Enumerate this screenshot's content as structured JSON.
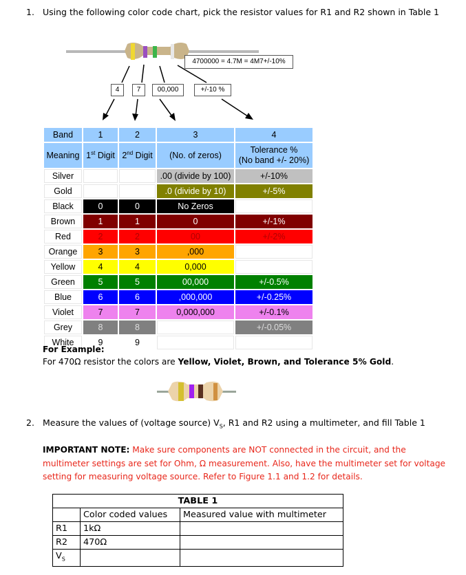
{
  "question1": {
    "number": "1.",
    "text": "Using the following color code chart, pick the resistor values for R1 and R2 shown in Table 1"
  },
  "diagram": {
    "equation": "4700000 = 4.7M = 4M7+/-10%",
    "callouts": [
      "4",
      "7",
      "00,000",
      "+/-10 %"
    ],
    "bands": [
      "#f0d830",
      "#9a4fc0",
      "#3cb54a",
      "#e8e8e8"
    ],
    "body_color": "#c9b48a"
  },
  "color_code_table": {
    "header_band": [
      "Band",
      "1",
      "2",
      "3",
      "4"
    ],
    "header_meaning": {
      "label": "Meaning",
      "digit1": "1",
      "digit1_sup": "st",
      "digit1_suffix": " Digit",
      "digit2": "2",
      "digit2_sup": "nd",
      "digit2_suffix": " Digit",
      "zeros": "(No. of zeros)",
      "tolerance_line1": "Tolerance %",
      "tolerance_line2": "(No band +/- 20%)"
    },
    "rows": [
      {
        "name": "Silver",
        "d1": "",
        "d2": "",
        "zeros": ".00 (divide by 100)",
        "tol": "+/-10%",
        "bg": "#c0c0c0",
        "fg": "#000000",
        "digit_bg": "",
        "zeros_bg": "#c0c0c0",
        "tol_bg": "#c0c0c0"
      },
      {
        "name": "Gold",
        "d1": "",
        "d2": "",
        "zeros": ".0 (divide by 10)",
        "tol": "+/-5%",
        "bg": "#808000",
        "fg": "#ffffff",
        "digit_bg": "",
        "zeros_bg": "#808000",
        "tol_bg": "#808000"
      },
      {
        "name": "Black",
        "d1": "0",
        "d2": "0",
        "zeros": "No Zeros",
        "tol": "",
        "bg": "#000000",
        "fg": "#ffffff",
        "digit_bg": "#000000",
        "zeros_bg": "#000000",
        "tol_bg": ""
      },
      {
        "name": "Brown",
        "d1": "1",
        "d2": "1",
        "zeros": "0",
        "tol": "+/-1%",
        "bg": "#800000",
        "fg": "#ffffff",
        "digit_bg": "#800000",
        "zeros_bg": "#800000",
        "tol_bg": "#800000"
      },
      {
        "name": "Red",
        "d1": "2",
        "d2": "2",
        "zeros": "00",
        "tol": "+/-2%",
        "bg": "#ff0000",
        "fg": "#b00000",
        "digit_bg": "#ff0000",
        "zeros_bg": "#ff0000",
        "tol_bg": "#ff0000"
      },
      {
        "name": "Orange",
        "d1": "3",
        "d2": "3",
        "zeros": ",000",
        "tol": "",
        "bg": "#ffa500",
        "fg": "#000000",
        "digit_bg": "#ffa500",
        "zeros_bg": "#ffa500",
        "tol_bg": ""
      },
      {
        "name": "Yellow",
        "d1": "4",
        "d2": "4",
        "zeros": "0,000",
        "tol": "",
        "bg": "#ffff00",
        "fg": "#000000",
        "digit_bg": "#ffff00",
        "zeros_bg": "#ffff00",
        "tol_bg": ""
      },
      {
        "name": "Green",
        "d1": "5",
        "d2": "5",
        "zeros": "00,000",
        "tol": "+/-0.5%",
        "bg": "#008000",
        "fg": "#ffffff",
        "digit_bg": "#008000",
        "zeros_bg": "#008000",
        "tol_bg": "#008000"
      },
      {
        "name": "Blue",
        "d1": "6",
        "d2": "6",
        "zeros": ",000,000",
        "tol": "+/-0.25%",
        "bg": "#0000ff",
        "fg": "#ffffff",
        "digit_bg": "#0000ff",
        "zeros_bg": "#0000ff",
        "tol_bg": "#0000ff"
      },
      {
        "name": "Violet",
        "d1": "7",
        "d2": "7",
        "zeros": "0,000,000",
        "tol": "+/-0.1%",
        "bg": "#ee82ee",
        "fg": "#000000",
        "digit_bg": "#ee82ee",
        "zeros_bg": "#ee82ee",
        "tol_bg": "#ee82ee"
      },
      {
        "name": "Grey",
        "d1": "8",
        "d2": "8",
        "zeros": "",
        "tol": "+/-0.05%",
        "bg": "#808080",
        "fg": "#dddddd",
        "digit_bg": "#808080",
        "zeros_bg": "",
        "tol_bg": "#808080"
      },
      {
        "name": "White",
        "d1": "9",
        "d2": "9",
        "zeros": "",
        "tol": "",
        "bg": "#ffffff",
        "fg": "#000000",
        "digit_bg": "#ffffff",
        "zeros_bg": "",
        "tol_bg": ""
      }
    ]
  },
  "example": {
    "heading": "For Example:",
    "text_prefix": "For 470Ω resistor the colors are ",
    "text_bold": "Yellow, Violet, Brown, and Tolerance 5% Gold",
    "text_suffix": ".",
    "resistor_bands": [
      "#d4c030",
      "#a020f0",
      "#5a3020",
      "#d09040"
    ]
  },
  "question2": {
    "number": "2.",
    "text_prefix": "Measure the values of (voltage source) V",
    "text_sub": "S",
    "text_suffix": ", R1 and R2 using a multimeter, and fill Table 1"
  },
  "note": {
    "label": "IMPORTANT NOTE:",
    "text": " Make sure components are NOT connected in the circuit, and the multimeter settings are set for Ohm, Ω measurement. Also, have the multimeter set for voltage setting for measuring voltage source. Refer to Figure 1.1 and 1.2 for details."
  },
  "table1": {
    "title": "TABLE 1",
    "headers": [
      "",
      "Color coded values",
      "Measured value with multimeter"
    ],
    "rows": [
      {
        "label": "R1",
        "label_sub": "",
        "color_value": "1kΩ",
        "measured": ""
      },
      {
        "label": "R2",
        "label_sub": "",
        "color_value": "470Ω",
        "measured": ""
      },
      {
        "label": "V",
        "label_sub": "S",
        "color_value": "",
        "measured": ""
      }
    ]
  }
}
